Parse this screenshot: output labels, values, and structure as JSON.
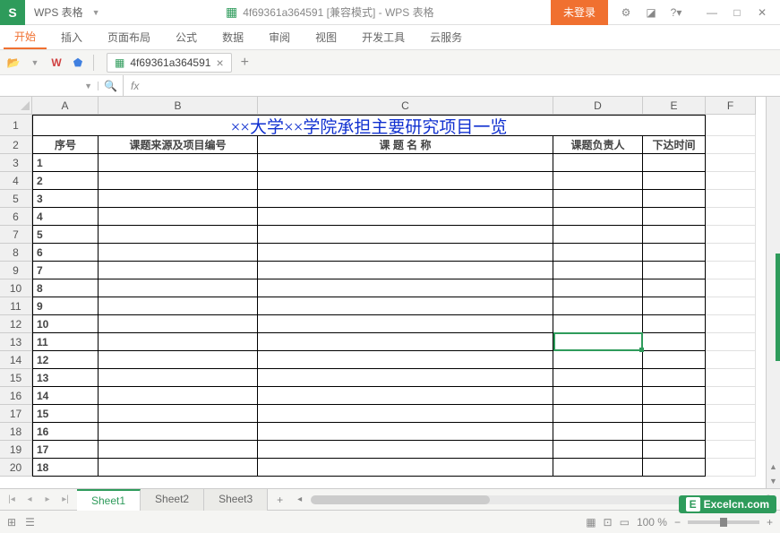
{
  "app": {
    "name": "WPS 表格",
    "doc_title": "4f69361a364591 [兼容模式] - WPS 表格",
    "login_label": "未登录"
  },
  "title_icons": {
    "gear": "⚙",
    "skin": "◪",
    "help": "?",
    "min": "—",
    "max": "□",
    "close": "✕"
  },
  "menu": {
    "start": "开始",
    "insert": "插入",
    "page_layout": "页面布局",
    "formulas": "公式",
    "data": "数据",
    "review": "审阅",
    "view": "视图",
    "dev": "开发工具",
    "cloud": "云服务"
  },
  "doc_tab": {
    "name": "4f69361a364591"
  },
  "formula": {
    "name_box": "",
    "fx": "fx",
    "value": ""
  },
  "columns": [
    "A",
    "B",
    "C",
    "D",
    "E",
    "F"
  ],
  "rows": [
    "1",
    "2",
    "3",
    "4",
    "5",
    "6",
    "7",
    "8",
    "9",
    "10",
    "11",
    "12",
    "13",
    "14",
    "15",
    "16",
    "17",
    "18",
    "19",
    "20"
  ],
  "sheet": {
    "title": "××大学××学院承担主要研究项目一览",
    "headers": {
      "seq": "序号",
      "source": "课题来源及项目编号",
      "name": "课  题  名  称",
      "owner": "课题负责人",
      "date": "下达时间"
    },
    "data_rows": [
      "1",
      "2",
      "3",
      "4",
      "5",
      "6",
      "7",
      "8",
      "9",
      "10",
      "11",
      "12",
      "13",
      "14",
      "15",
      "16",
      "17",
      "18"
    ]
  },
  "active_cell": {
    "row": 12,
    "col": "D"
  },
  "sheets": {
    "s1": "Sheet1",
    "s2": "Sheet2",
    "s3": "Sheet3"
  },
  "status": {
    "zoom": "100 %",
    "views": "☰"
  },
  "watermark": "Excelcn.com"
}
